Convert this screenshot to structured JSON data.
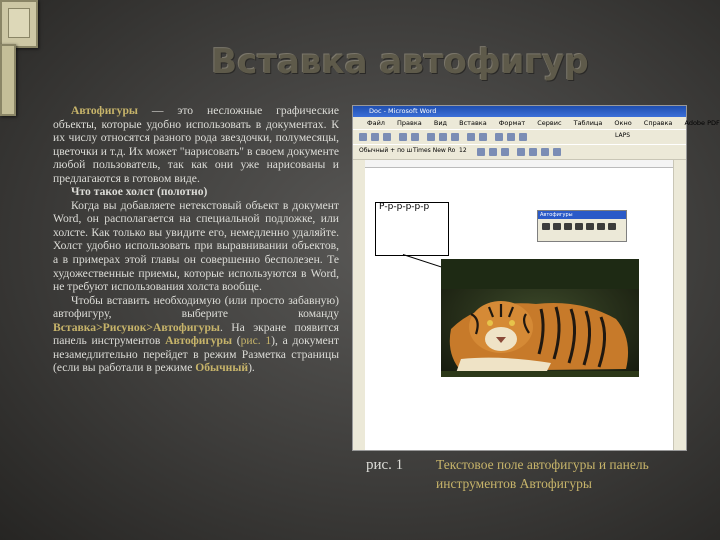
{
  "title": "Вставка автофигур",
  "p1": {
    "term": "Автофигуры",
    "text": " — это несложные графические объекты, которые удобно использовать в документах. К их числу относятся разного рода звездочки, полумесяцы, цветочки и т.д. Их может \"нарисовать\" в своем документе любой пользователь, так как они уже нарисованы и предлагаются в готовом виде."
  },
  "p2": "Что такое холст (полотно)",
  "p3": "Когда вы добавляете нетекстовый объект в документ Word, он располагается на специальной подложке, или холсте. Как только вы увидите его, немедленно удаляйте. Холст удобно использовать при выравнивании объектов, а в примерах этой главы он совершенно бесполезен. Те художественные приемы, которые используются в Word, не требуют использования холста вообще.",
  "p4": {
    "t1": "Чтобы вставить необходимую (или просто забавную) автофигуру, выберите команду ",
    "menu_path": "Вставка>Рисунок>Автофигуры",
    "t2": ". На экране появится панель инструментов ",
    "toolbar_name": "Автофигуры",
    "t3": " (",
    "fig_ref": "рис. 1",
    "t4": "), а документ незамедлительно перейдет в режим Разметка страницы (если вы работали в режиме ",
    "mode_name": "Обычный",
    "t5": ")."
  },
  "screenshot": {
    "window_title": "Doc - Microsoft Word",
    "menu": [
      "Файл",
      "Правка",
      "Вид",
      "Вставка",
      "Формат",
      "Сервис",
      "Таблица",
      "Окно",
      "Справка",
      "Adobe PDF"
    ],
    "style_box": "Обычный + по ш",
    "font_box": "Times New Ro",
    "size_box": "12",
    "font_name_2": "LAPS",
    "doc_text": "Р-р-р-р-р-р",
    "palette_title": "Автофигуры"
  },
  "caption": {
    "label": "рис. 1",
    "text": "Текстовое поле автофигуры и панель инструментов Автофигуры"
  },
  "colors": {
    "accent": "#c7b46a",
    "body_text": "#ddddd8",
    "title": "#5e5a4a",
    "background": "#3e3d3b"
  }
}
